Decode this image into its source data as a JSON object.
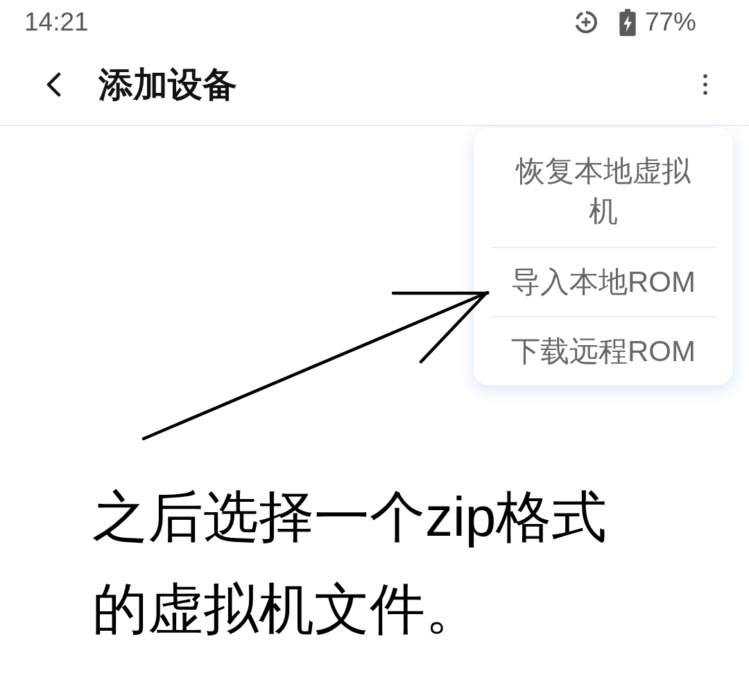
{
  "status_bar": {
    "time": "14:21",
    "battery": "77%"
  },
  "app_bar": {
    "title": "添加设备"
  },
  "menu": {
    "items": [
      {
        "label": "恢复本地虚拟机"
      },
      {
        "label": "导入本地ROM"
      },
      {
        "label": "下载远程ROM"
      }
    ]
  },
  "caption": "之后选择一个zip格式的虚拟机文件。"
}
